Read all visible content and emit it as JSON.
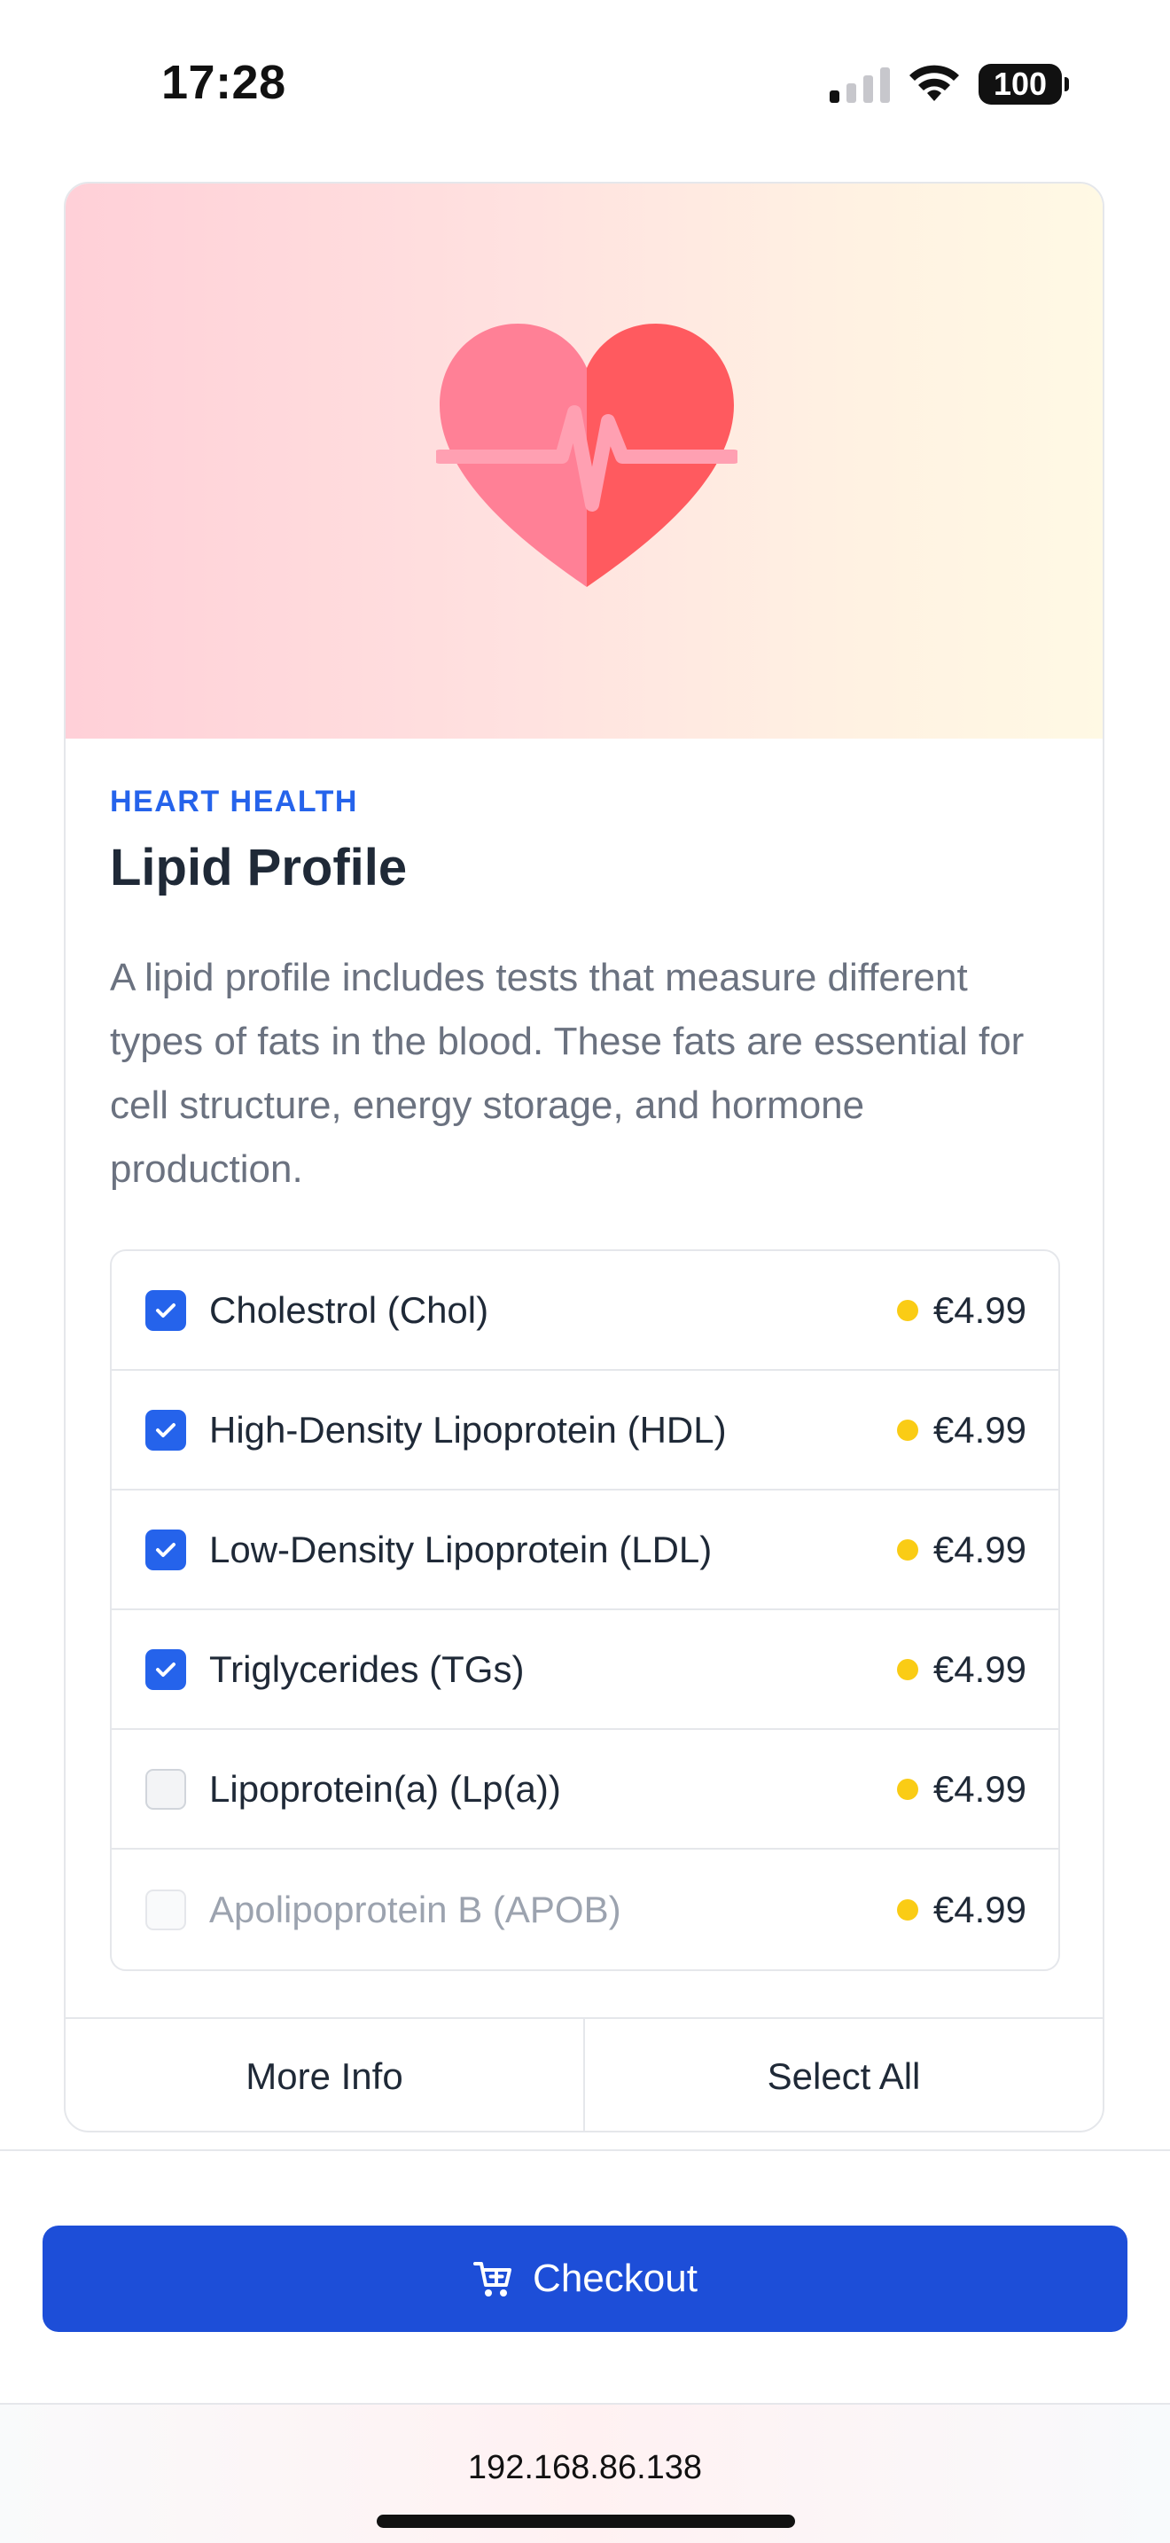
{
  "status_bar": {
    "time": "17:28",
    "battery": "100",
    "icons": [
      "cellular-signal-icon",
      "wifi-icon",
      "battery-icon"
    ]
  },
  "card": {
    "hero_icon": "heart-ecg-icon",
    "category": "HEART HEALTH",
    "title": "Lipid Profile",
    "description": "A lipid profile includes tests that measure different types of fats in the blood. These fats are essential for cell structure, energy storage, and hormone production.",
    "tests": [
      {
        "name": "Cholestrol (Chol)",
        "price": "€4.99",
        "checked": true,
        "disabled": false
      },
      {
        "name": "High-Density Lipoprotein (HDL)",
        "price": "€4.99",
        "checked": true,
        "disabled": false
      },
      {
        "name": "Low-Density Lipoprotein (LDL)",
        "price": "€4.99",
        "checked": true,
        "disabled": false
      },
      {
        "name": "Triglycerides (TGs)",
        "price": "€4.99",
        "checked": true,
        "disabled": false
      },
      {
        "name": "Lipoprotein(a) (Lp(a))",
        "price": "€4.99",
        "checked": false,
        "disabled": false
      },
      {
        "name": "Apolipoprotein B (APOB)",
        "price": "€4.99",
        "checked": false,
        "disabled": true
      }
    ],
    "actions": {
      "more_info": "More Info",
      "select_all": "Select All"
    }
  },
  "checkout": {
    "label": "Checkout",
    "icon": "cart-icon"
  },
  "browser": {
    "url": "192.168.86.138"
  },
  "colors": {
    "accent": "#2563eb",
    "checkout_button": "#1d4ed8",
    "price_dot": "#facc15",
    "heart_left": "#ff7f93",
    "heart_right": "#ff5a5f"
  }
}
